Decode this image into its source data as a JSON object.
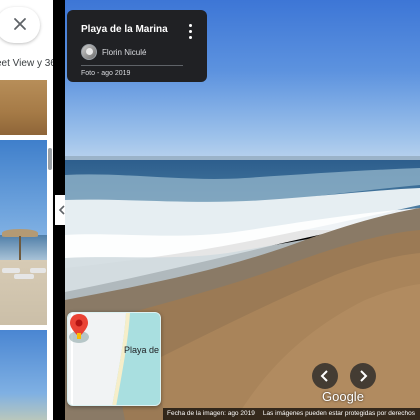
{
  "panel": {
    "photo_caption": "eet View y 36"
  },
  "info_card": {
    "title": "Playa de la Marina",
    "author": "Florin Niculé",
    "date": "Foto - ago 2019"
  },
  "minimap": {
    "label": "Playa de"
  },
  "branding": {
    "logo": "Google"
  },
  "footer": {
    "image_date": "Fecha de la imagen: ago 2019",
    "rights": "Las imágenes pueden estar protegidas por derechos"
  },
  "icons": {
    "close": "close-icon",
    "expand": "chevron-left-icon",
    "more": "more-vert-icon",
    "prev": "chevron-left-icon",
    "next": "chevron-right-icon",
    "pin": "map-pin-icon"
  },
  "colors": {
    "card_bg": "#202124",
    "pin_red": "#ea4335"
  }
}
